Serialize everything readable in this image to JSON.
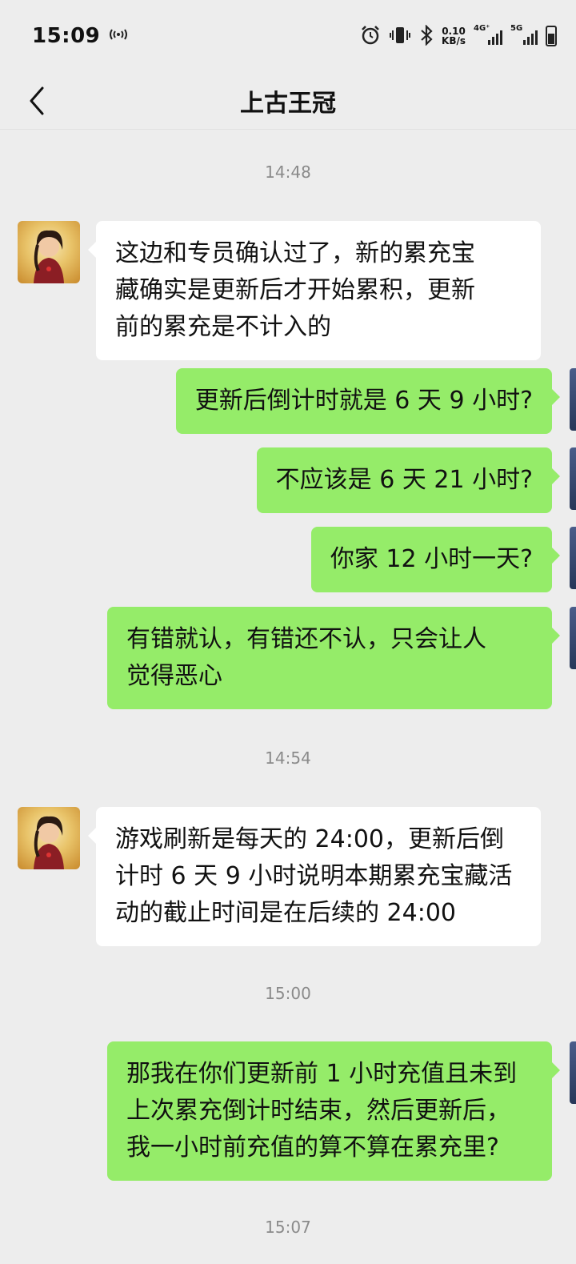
{
  "status_bar": {
    "time": "15:09",
    "net_speed_value": "0.10",
    "net_speed_unit": "KB/s",
    "network_4g": "4G⁺",
    "network_5g": "5G",
    "icons": [
      "signal-wave-icon",
      "alarm-icon",
      "vibrate-icon",
      "bluetooth-icon",
      "cellular-signal-icon",
      "battery-icon"
    ]
  },
  "header": {
    "title": "上古王冠",
    "back_icon": "chevron-left-icon"
  },
  "messages": [
    {
      "type": "time",
      "text": "14:48"
    },
    {
      "type": "incoming",
      "text": "这边和专员确认过了，新的累充宝\n藏确实是更新后才开始累积，更新\n前的累充是不计入的"
    },
    {
      "type": "outgoing",
      "text": "更新后倒计时就是 6 天 9 小时?"
    },
    {
      "type": "outgoing",
      "text": "不应该是 6 天 21 小时?"
    },
    {
      "type": "outgoing",
      "text": "你家 12 小时一天?"
    },
    {
      "type": "outgoing",
      "text": "有错就认，有错还不认，只会让人\n觉得恶心"
    },
    {
      "type": "time",
      "text": "14:54"
    },
    {
      "type": "incoming",
      "text": "游戏刷新是每天的 24:00，更新后倒\n计时 6 天 9 小时说明本期累充宝藏活\n动的截止时间是在后续的 24:00"
    },
    {
      "type": "time",
      "text": "15:00"
    },
    {
      "type": "outgoing",
      "text": "那我在你们更新前 1 小时充值且未到\n上次累充倒计时结束，然后更新后，\n我一小时前充值的算不算在累充里?"
    },
    {
      "type": "time",
      "text": "15:07"
    }
  ],
  "colors": {
    "background": "#ededed",
    "outgoing_bubble": "#95ec69",
    "incoming_bubble": "#ffffff",
    "timestamp_text": "#8a8a8a"
  }
}
